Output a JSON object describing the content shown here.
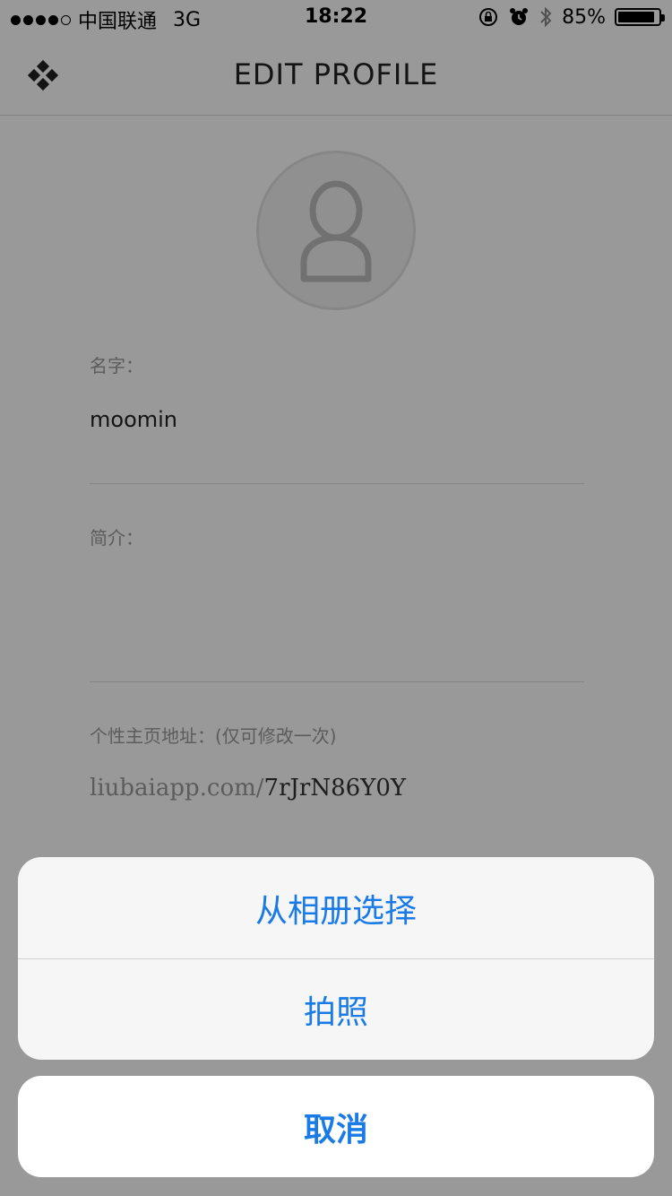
{
  "status_bar": {
    "carrier": "中国联通",
    "network": "3G",
    "time": "18:22",
    "battery": "85%"
  },
  "nav": {
    "title": "EDIT PROFILE",
    "menu_icon": "diamond-grid-icon"
  },
  "avatar": {
    "icon": "user-silhouette-icon"
  },
  "form": {
    "name_label": "名字：",
    "name_value": "moomin",
    "bio_label": "简介：",
    "bio_value": "",
    "url_label": "个性主页地址：(仅可修改一次)",
    "url_prefix": "liubaiapp.com/",
    "url_code": "7rJrN86Y0Y"
  },
  "action_sheet": {
    "choose_from_album": "从相册选择",
    "take_photo": "拍照",
    "cancel": "取消",
    "accent_color": "#1a7be6"
  }
}
